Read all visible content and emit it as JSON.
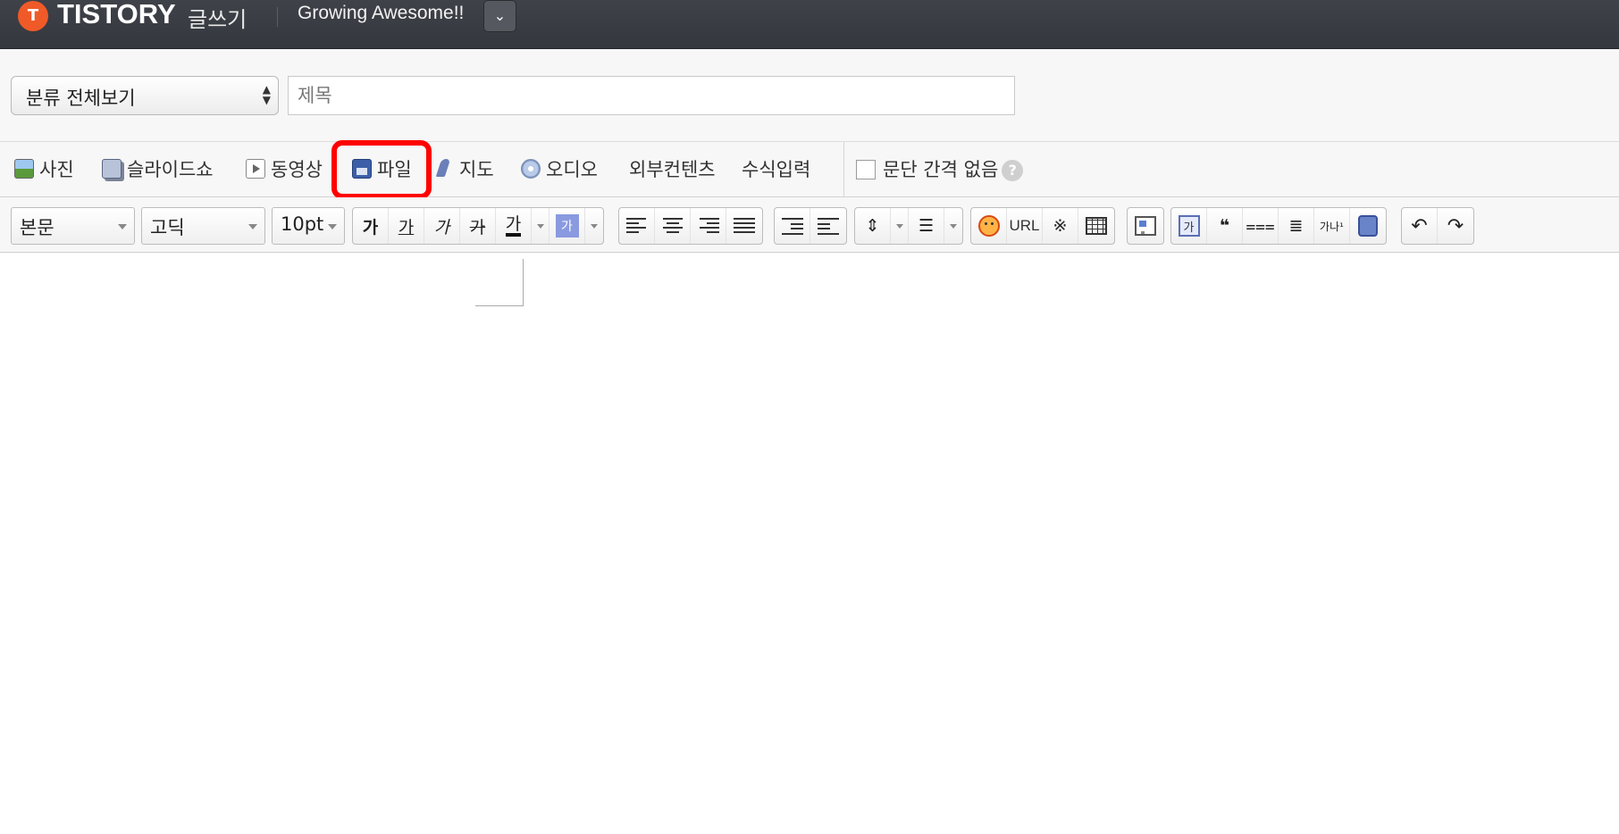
{
  "header": {
    "logo_glyph": "T",
    "logo_text": "TISTORY",
    "logo_sub": "글쓰기",
    "blog_name": "Growing Awesome!!",
    "blog_dropdown_glyph": "⌄"
  },
  "title_row": {
    "category_value": "분류 전체보기",
    "title_placeholder": "제목",
    "title_value": ""
  },
  "insert_toolbar": {
    "items": [
      {
        "label": "사진",
        "icon": "photo-icon"
      },
      {
        "label": "슬라이드쇼",
        "icon": "slideshow-icon"
      },
      {
        "label": "동영상",
        "icon": "video-icon"
      },
      {
        "label": "파일",
        "icon": "file-icon"
      },
      {
        "label": "지도",
        "icon": "map-icon"
      },
      {
        "label": "오디오",
        "icon": "audio-icon"
      },
      {
        "label": "외부컨텐츠",
        "icon": ""
      },
      {
        "label": "수식입력",
        "icon": ""
      }
    ],
    "paragraph_spacing_label": "문단 간격 없음",
    "paragraph_spacing_checked": false,
    "help_glyph": "?"
  },
  "format_toolbar": {
    "paragraph_style": "본문",
    "font_family": "고딕",
    "font_size": "10pt",
    "bold_glyph": "가",
    "underline_glyph": "가",
    "italic_glyph": "가",
    "strike_glyph": "가",
    "text_color_glyph": "가",
    "highlight_glyph": "가",
    "url_label": "URL",
    "special_char_glyph": "※",
    "box_glyph": "가",
    "quote_glyph": "❝",
    "furigana_glyph": "가나¹"
  },
  "colors": {
    "topbar": "#3a3d43",
    "brand_orange": "#f05a28",
    "highlight_red": "#ff0000",
    "toolbar_bg": "#f7f7f7"
  }
}
